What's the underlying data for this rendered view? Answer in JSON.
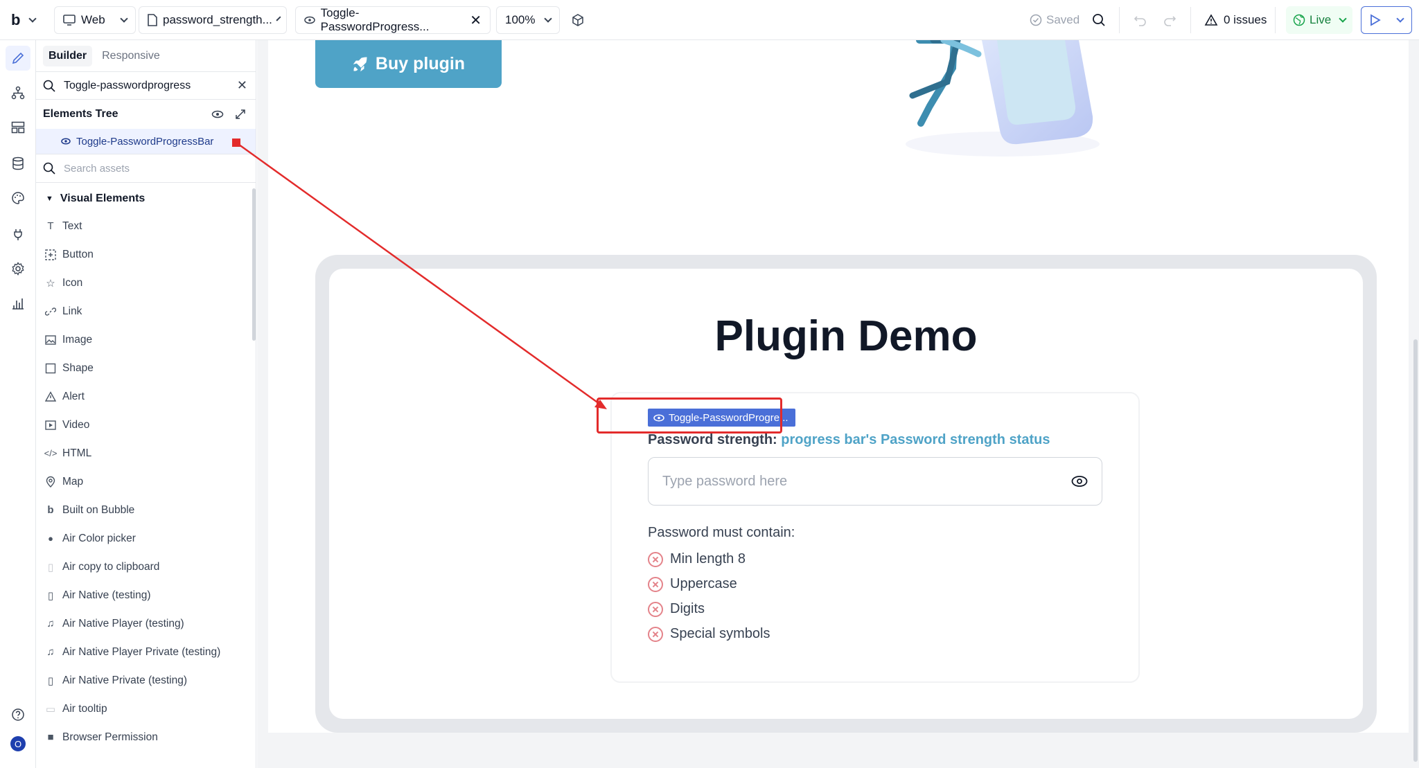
{
  "topbar": {
    "logo": "b",
    "platform": "Web",
    "page_name": "password_strength...",
    "element_tab": "Toggle-PasswordProgress...",
    "zoom": "100%",
    "saved": "Saved",
    "issues": "0 issues",
    "live": "Live"
  },
  "panel": {
    "tabs": [
      "Builder",
      "Responsive"
    ],
    "search_value": "Toggle-passwordprogress",
    "tree_title": "Elements Tree",
    "tree_item": "Toggle-PasswordProgressBar",
    "assets_placeholder": "Search assets",
    "category": "Visual Elements",
    "elements": [
      {
        "label": "Text",
        "icon": "text-icon"
      },
      {
        "label": "Button",
        "icon": "button-icon"
      },
      {
        "label": "Icon",
        "icon": "star-icon"
      },
      {
        "label": "Link",
        "icon": "link-icon"
      },
      {
        "label": "Image",
        "icon": "image-icon"
      },
      {
        "label": "Shape",
        "icon": "square-icon"
      },
      {
        "label": "Alert",
        "icon": "warning-icon"
      },
      {
        "label": "Video",
        "icon": "video-icon"
      },
      {
        "label": "HTML",
        "icon": "code-icon"
      },
      {
        "label": "Map",
        "icon": "map-pin-icon"
      },
      {
        "label": "Built on Bubble",
        "icon": "bubble-logo-icon"
      },
      {
        "label": "Air Color picker",
        "icon": "palette-icon"
      },
      {
        "label": "Air copy to clipboard",
        "icon": "clipboard-icon"
      },
      {
        "label": "Air Native (testing)",
        "icon": "phone-icon"
      },
      {
        "label": "Air Native Player (testing)",
        "icon": "music-icon"
      },
      {
        "label": "Air Native Player Private (testing)",
        "icon": "music-icon"
      },
      {
        "label": "Air Native Private (testing)",
        "icon": "phone-icon"
      },
      {
        "label": "Air tooltip",
        "icon": "tooltip-icon"
      },
      {
        "label": "Browser Permission",
        "icon": "square-filled-icon"
      }
    ]
  },
  "canvas": {
    "buy_button": "Buy plugin",
    "demo_title": "Plugin Demo",
    "element_tag": "Toggle-PasswordProgre...",
    "strength_label": "Password strength:",
    "strength_status": "progress bar's Password strength status",
    "password_placeholder": "Type password here",
    "must_contain": "Password must contain:",
    "requirements": [
      "Min length 8",
      "Uppercase",
      "Digits",
      "Special symbols"
    ]
  },
  "rail": {
    "avatar_letter": "O"
  },
  "colors": {
    "accent": "#4fa3c7",
    "tag": "#4a6fd8",
    "annotation": "#e32b2b",
    "error": "#e4838a"
  }
}
